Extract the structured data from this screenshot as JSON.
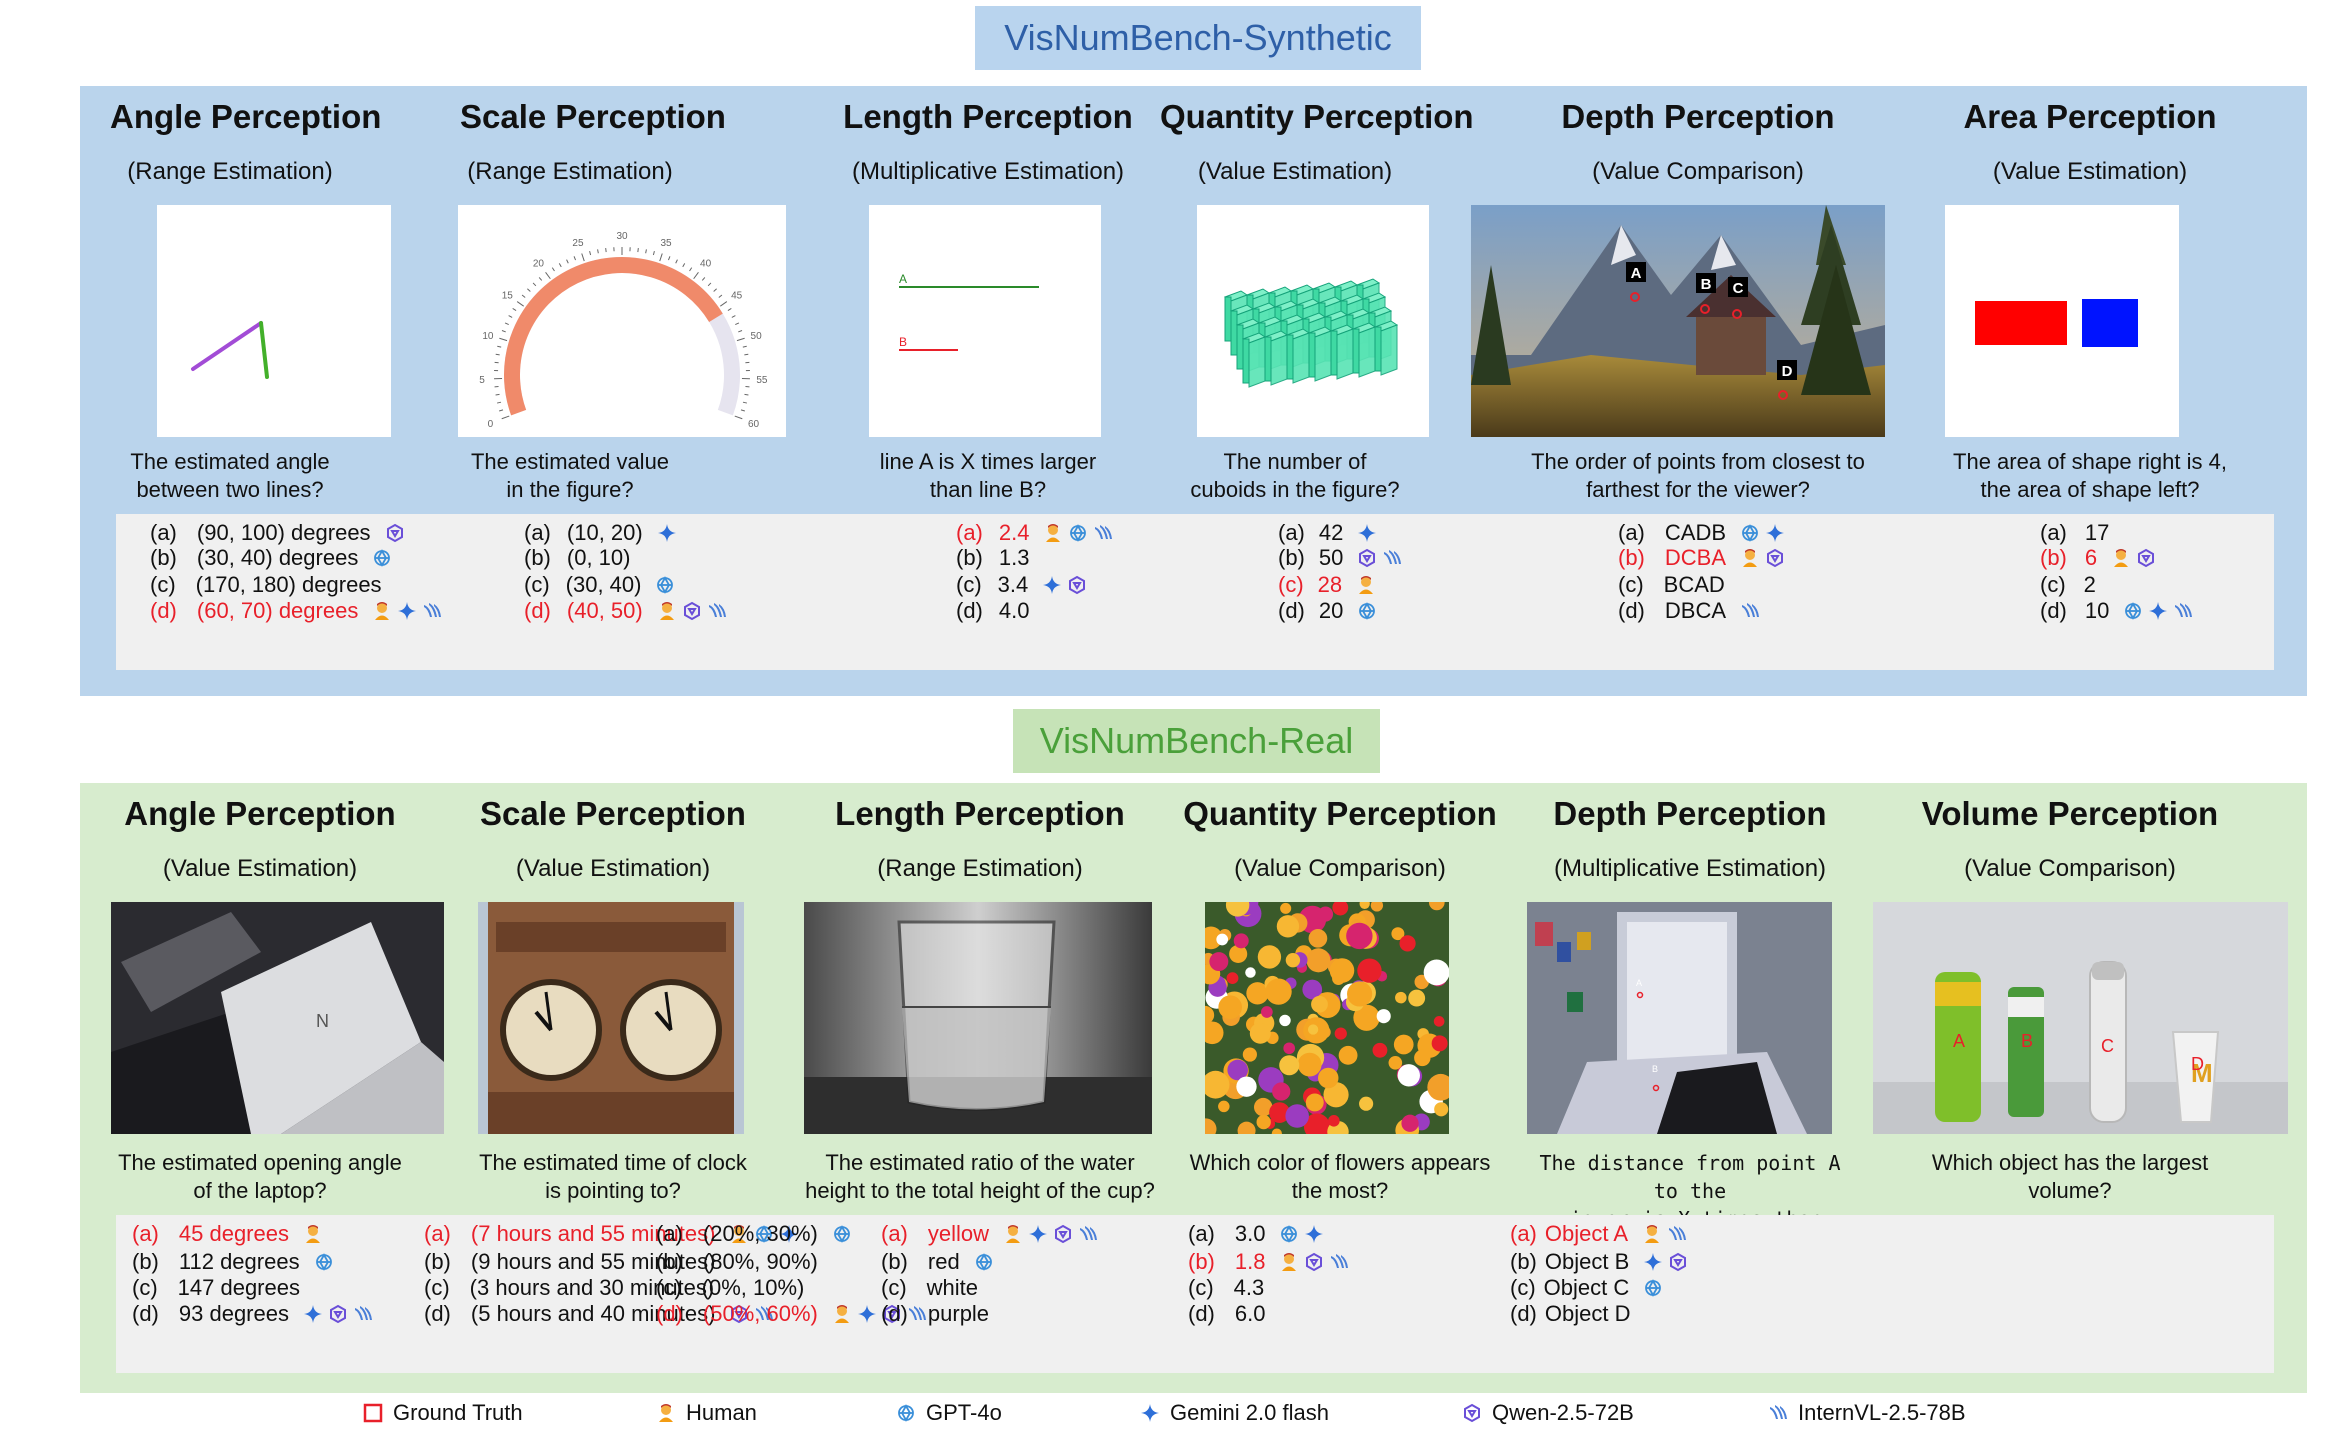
{
  "synthetic": {
    "title": "VisNumBench-Synthetic",
    "columns": [
      {
        "title": "Angle Perception",
        "subtitle": "(Range Estimation)",
        "question": [
          "The estimated angle",
          "between two lines?"
        ],
        "options": [
          {
            "label": "(a)",
            "value": "(90, 100) degrees",
            "icons": [
              "qwen-icon"
            ]
          },
          {
            "label": "(b)",
            "value": "(30, 40) degrees",
            "icons": [
              "gpt-icon"
            ]
          },
          {
            "label": "(c)",
            "value": "(170, 180) degrees",
            "icons": []
          },
          {
            "label": "(d)",
            "value": "(60, 70) degrees",
            "icons": [
              "human-icon",
              "gemini-icon",
              "internvl-icon"
            ],
            "gt": true
          }
        ]
      },
      {
        "title": "Scale Perception",
        "subtitle": "(Range Estimation)",
        "question": [
          "The estimated value",
          "in the figure?"
        ],
        "gauge_ticks": [
          "0",
          "5",
          "10",
          "15",
          "20",
          "25",
          "30",
          "35",
          "40",
          "45",
          "50",
          "55",
          "60"
        ],
        "options": [
          {
            "label": "(a)",
            "value": "(10, 20)",
            "icons": [
              "gemini-icon"
            ]
          },
          {
            "label": "(b)",
            "value": "(0, 10)",
            "icons": []
          },
          {
            "label": "(c)",
            "value": "(30, 40)",
            "icons": [
              "gpt-icon"
            ]
          },
          {
            "label": "(d)",
            "value": "(40, 50)",
            "icons": [
              "human-icon",
              "qwen-icon",
              "internvl-icon"
            ],
            "gt": true
          }
        ]
      },
      {
        "title": "Length Perception",
        "subtitle": "(Multiplicative Estimation)",
        "question": [
          "line A is X times larger",
          "than line B?"
        ],
        "line_labels": [
          "A",
          "B"
        ],
        "options": [
          {
            "label": "(a)",
            "value": "2.4",
            "icons": [
              "human-icon",
              "gpt-icon",
              "internvl-icon"
            ],
            "gt": true
          },
          {
            "label": "(b)",
            "value": "1.3",
            "icons": []
          },
          {
            "label": "(c)",
            "value": "3.4",
            "icons": [
              "gemini-icon",
              "qwen-icon"
            ]
          },
          {
            "label": "(d)",
            "value": "4.0",
            "icons": []
          }
        ]
      },
      {
        "title": "Quantity Perception",
        "subtitle": "(Value Estimation)",
        "question": [
          "The number of",
          "cuboids in the figure?"
        ],
        "options": [
          {
            "label": "(a)",
            "value": "42",
            "icons": [
              "gemini-icon"
            ]
          },
          {
            "label": "(b)",
            "value": "50",
            "icons": [
              "qwen-icon",
              "internvl-icon"
            ]
          },
          {
            "label": "(c)",
            "value": "28",
            "icons": [
              "human-icon"
            ],
            "gt": true
          },
          {
            "label": "(d)",
            "value": "20",
            "icons": [
              "gpt-icon"
            ]
          }
        ]
      },
      {
        "title": "Depth Perception",
        "subtitle": "(Value Comparison)",
        "question": [
          "The order of points from closest to",
          "farthest for the viewer?"
        ],
        "point_labels": [
          "A",
          "B",
          "C",
          "D"
        ],
        "options": [
          {
            "label": "(a)",
            "value": "CADB",
            "icons": [
              "gpt-icon",
              "gemini-icon"
            ]
          },
          {
            "label": "(b)",
            "value": "DCBA",
            "icons": [
              "human-icon",
              "qwen-icon"
            ],
            "gt": true
          },
          {
            "label": "(c)",
            "value": "BCAD",
            "icons": []
          },
          {
            "label": "(d)",
            "value": "DBCA",
            "icons": [
              "internvl-icon"
            ]
          }
        ]
      },
      {
        "title": "Area Perception",
        "subtitle": "(Value Estimation)",
        "question": [
          "The area of shape right is 4,",
          "the area of shape left?"
        ],
        "options": [
          {
            "label": "(a)",
            "value": "17",
            "icons": []
          },
          {
            "label": "(b)",
            "value": "6",
            "icons": [
              "human-icon",
              "qwen-icon"
            ],
            "gt": true
          },
          {
            "label": "(c)",
            "value": "2",
            "icons": []
          },
          {
            "label": "(d)",
            "value": "10",
            "icons": [
              "gpt-icon",
              "gemini-icon",
              "internvl-icon"
            ]
          }
        ]
      }
    ]
  },
  "real": {
    "title": "VisNumBench-Real",
    "columns": [
      {
        "title": "Angle Perception",
        "subtitle": "(Value Estimation)",
        "question": [
          "The estimated opening angle",
          "of the laptop?"
        ],
        "options": [
          {
            "label": "(a)",
            "value": "45 degrees",
            "icons": [
              "human-icon"
            ],
            "gt": true
          },
          {
            "label": "(b)",
            "value": "112 degrees",
            "icons": [
              "gpt-icon"
            ]
          },
          {
            "label": "(c)",
            "value": "147 degrees",
            "icons": []
          },
          {
            "label": "(d)",
            "value": "93 degrees",
            "icons": [
              "gemini-icon",
              "qwen-icon",
              "internvl-icon"
            ]
          }
        ]
      },
      {
        "title": "Scale Perception",
        "subtitle": "(Value Estimation)",
        "question": [
          "The estimated time of clock",
          "is pointing to?"
        ],
        "options": [
          {
            "label": "(a)",
            "value": "(7 hours and 55 minutes)",
            "icons": [
              "human-icon",
              "gpt-icon",
              "gemini-icon"
            ],
            "gt": true
          },
          {
            "label": "(b)",
            "value": "(9 hours and 55 minutes)",
            "icons": []
          },
          {
            "label": "(c)",
            "value": "(3 hours and 30 minutes)",
            "icons": []
          },
          {
            "label": "(d)",
            "value": "(5 hours and 40 minutes)",
            "icons": [
              "qwen-icon",
              "internvl-icon"
            ]
          }
        ]
      },
      {
        "title": "Length Perception",
        "subtitle": "(Range Estimation)",
        "question": [
          "The estimated ratio of the water",
          "height to the total height of the cup?"
        ],
        "options": [
          {
            "label": "(a)",
            "value": "(20%, 30%)",
            "icons": [
              "gpt-icon"
            ]
          },
          {
            "label": "(b)",
            "value": "(80%, 90%)",
            "icons": []
          },
          {
            "label": "(c)",
            "value": "(0%, 10%)",
            "icons": []
          },
          {
            "label": "(d)",
            "value": "(50%, 60%)",
            "icons": [
              "human-icon",
              "gemini-icon",
              "qwen-icon",
              "internvl-icon"
            ],
            "gt": true
          }
        ]
      },
      {
        "title": "Quantity Perception",
        "subtitle": "(Value Comparison)",
        "question": [
          "Which color of flowers appears",
          "the most?"
        ],
        "options": [
          {
            "label": "(a)",
            "value": "yellow",
            "icons": [
              "human-icon",
              "gemini-icon",
              "qwen-icon",
              "internvl-icon"
            ],
            "gt": true
          },
          {
            "label": "(b)",
            "value": "red",
            "icons": [
              "gpt-icon"
            ]
          },
          {
            "label": "(c)",
            "value": "white",
            "icons": []
          },
          {
            "label": "(d)",
            "value": "purple",
            "icons": []
          }
        ]
      },
      {
        "title": "Depth Perception",
        "subtitle": "(Multiplicative Estimation)",
        "question": [
          "The distance from point A to the",
          "viewer is X times than point B?"
        ],
        "point_labels": [
          "A",
          "B"
        ],
        "options": [
          {
            "label": "(a)",
            "value": "3.0",
            "icons": [
              "gpt-icon",
              "gemini-icon"
            ]
          },
          {
            "label": "(b)",
            "value": "1.8",
            "icons": [
              "human-icon",
              "qwen-icon",
              "internvl-icon"
            ],
            "gt": true
          },
          {
            "label": "(c)",
            "value": "4.3",
            "icons": []
          },
          {
            "label": "(d)",
            "value": "6.0",
            "icons": []
          }
        ]
      },
      {
        "title": "Volume Perception",
        "subtitle": "(Value Comparison)",
        "question": [
          "Which object has the largest",
          "volume?"
        ],
        "object_labels": [
          "A",
          "B",
          "C",
          "D"
        ],
        "options": [
          {
            "label": "(a)",
            "value": "Object A",
            "icons": [
              "human-icon",
              "internvl-icon"
            ],
            "gt": true
          },
          {
            "label": "(b)",
            "value": "Object B",
            "icons": [
              "gemini-icon",
              "qwen-icon"
            ]
          },
          {
            "label": "(c)",
            "value": "Object C",
            "icons": [
              "gpt-icon"
            ]
          },
          {
            "label": "(d)",
            "value": "Object D",
            "icons": []
          }
        ]
      }
    ]
  },
  "legend": [
    {
      "icon": "ground-truth-icon",
      "label": "Ground Truth"
    },
    {
      "icon": "human-icon",
      "label": "Human"
    },
    {
      "icon": "gpt-icon",
      "label": "GPT-4o"
    },
    {
      "icon": "gemini-icon",
      "label": "Gemini 2.0 flash"
    },
    {
      "icon": "qwen-icon",
      "label": "Qwen-2.5-72B"
    },
    {
      "icon": "internvl-icon",
      "label": "InternVL-2.5-78B"
    }
  ],
  "colors": {
    "ground_truth": "#e8202a",
    "synthetic_bg": "#bad4ec",
    "real_bg": "#d7ecce",
    "options_bg": "#f0f0f0"
  }
}
